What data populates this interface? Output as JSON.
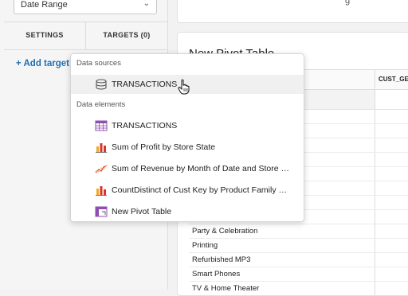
{
  "left_panel": {
    "date_select_value": "Date Range",
    "tabs": [
      {
        "label": "SETTINGS"
      },
      {
        "label": "TARGETS (0)"
      }
    ],
    "add_target_label": "+ Add target"
  },
  "top_card": {
    "partial_text": "g"
  },
  "pivot": {
    "title": "New Pivot Table",
    "header_col2": "CUST_GE",
    "rows": [
      "",
      "",
      "",
      "",
      "",
      "",
      "",
      "",
      "Party & Celebration",
      "Printing",
      "Refurbished MP3",
      "Smart Phones",
      "TV & Home Theater"
    ]
  },
  "dropdown": {
    "section_data_sources": "Data sources",
    "data_sources": [
      {
        "label": "TRANSACTIONS",
        "icon": "database-icon"
      }
    ],
    "section_data_elements": "Data elements",
    "data_elements": [
      {
        "label": "TRANSACTIONS",
        "icon": "table-icon"
      },
      {
        "label": "Sum of Profit by Store State",
        "icon": "bar-chart-icon"
      },
      {
        "label": "Sum of Revenue by Month of Date and Store …",
        "icon": "line-chart-icon"
      },
      {
        "label": "CountDistinct of Cust Key by Product Family …",
        "icon": "bar-chart-icon"
      },
      {
        "label": "New Pivot Table",
        "icon": "pivot-table-icon"
      }
    ]
  },
  "colors": {
    "accent": "#1f6fb2",
    "chart_red": "#d9342b",
    "chart_orange": "#f5a623",
    "table_purple": "#8e4fb0"
  }
}
